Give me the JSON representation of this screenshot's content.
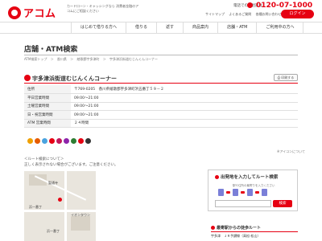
{
  "header": {
    "logo_text": "アコム",
    "tagline": "カードローン・キャッシングなら 消費者金融のアコムにご相談ください",
    "phone_label": "電話でのご相談は",
    "phone_number": "0120-07-1000",
    "top_links": [
      "サイトマップ",
      "よくあるご質問",
      "各種お問い合わせ",
      "企業情報サイト"
    ],
    "login_label": "ログイン"
  },
  "nav": {
    "items": [
      "はじめて借りる方へ",
      "借りる",
      "返す",
      "商品案内",
      "店舗・ATM",
      "ご利用中の方へ"
    ]
  },
  "page": {
    "title": "店舗・ATM検索",
    "breadcrumb": [
      "ATM検索トップ",
      "＞",
      "香川県",
      "＞",
      "綾歌郡宇多津町",
      "＞",
      "宇多津浜街道むじんくんコーナー"
    ]
  },
  "store": {
    "name": "宇多津浜街道むじんくんコーナー",
    "print_label": "印刷する",
    "rows": [
      {
        "label": "住所",
        "value": "〒769-0205　香川県綾歌郡宇多津町浜五番丁５９－２"
      },
      {
        "label": "平日営業時間",
        "value": "09:00～21:00"
      },
      {
        "label": "土曜営業時間",
        "value": "09:00～21:00"
      },
      {
        "label": "日・祝営業時間",
        "value": "09:00～21:00"
      },
      {
        "label": "ATM 営業時間",
        "value": "２４時間"
      }
    ],
    "service_colors": [
      "#f0a000",
      "#e65c00",
      "#4aa3df",
      "#e60012",
      "#c2185b",
      "#8e24aa",
      "#2e7d32",
      "#e60012",
      "#333333"
    ],
    "icon_note": "※アイコンについて"
  },
  "route": {
    "heading": "＜ルート検索について＞",
    "note": "正しく表示されない場合がございます。ご注意ください。"
  },
  "map": {
    "labels": [
      "聖通寺",
      "浜一番丁",
      "浜一番丁",
      "イオンタウン"
    ]
  },
  "route_panel": {
    "title": "出発地を入力してルート検索",
    "sub": "駅や住所の最寄りを入力ください",
    "button": "検索"
  },
  "station": {
    "title": "最寄駅からの徒歩ルート",
    "item": "宇多津　ＪＲ予讃線（高松-松山）"
  }
}
